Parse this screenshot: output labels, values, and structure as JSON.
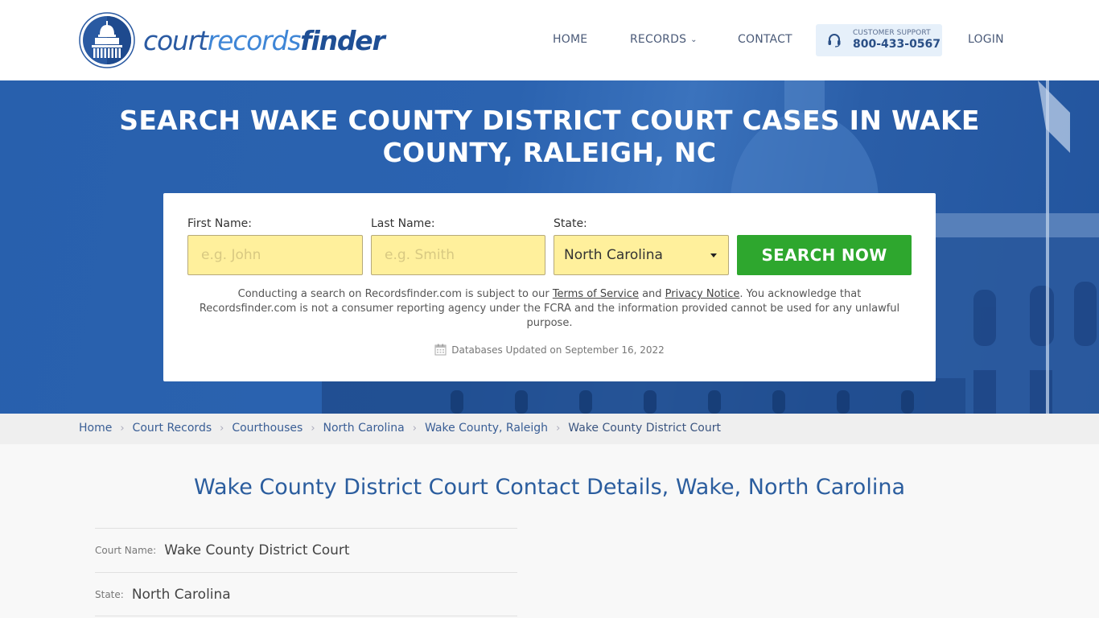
{
  "header": {
    "logo": {
      "part1": "court",
      "part2": "records",
      "part3": "finder"
    },
    "nav": [
      {
        "label": "HOME"
      },
      {
        "label": "RECORDS",
        "has_dropdown": true
      },
      {
        "label": "CONTACT"
      }
    ],
    "support": {
      "label": "CUSTOMER SUPPORT",
      "phone": "800-433-0567",
      "icon": "headset-icon"
    },
    "login_label": "LOGIN"
  },
  "hero": {
    "title": "SEARCH WAKE COUNTY DISTRICT COURT CASES IN WAKE COUNTY, RALEIGH, NC",
    "form": {
      "first_name": {
        "label": "First Name:",
        "placeholder": "e.g. John",
        "value": ""
      },
      "last_name": {
        "label": "Last Name:",
        "placeholder": "e.g. Smith",
        "value": ""
      },
      "state": {
        "label": "State:",
        "selected": "North Carolina"
      },
      "submit_label": "SEARCH NOW"
    },
    "disclaimer": {
      "pre": "Conducting a search on Recordsfinder.com is subject to our ",
      "terms": "Terms of Service",
      "and": " and ",
      "privacy": "Privacy Notice",
      "post": ". You acknowledge that Recordsfinder.com is not a consumer reporting agency under the FCRA and the information provided cannot be used for any unlawful purpose."
    },
    "updated": "Databases Updated on September 16, 2022"
  },
  "breadcrumb": [
    {
      "label": "Home"
    },
    {
      "label": "Court Records"
    },
    {
      "label": "Courthouses"
    },
    {
      "label": "North Carolina"
    },
    {
      "label": "Wake County, Raleigh"
    },
    {
      "label": "Wake County District Court"
    }
  ],
  "main": {
    "title": "Wake County District Court Contact Details, Wake, North Carolina",
    "details": [
      {
        "key": "Court Name:",
        "value": "Wake County District Court"
      },
      {
        "key": "State:",
        "value": "North Carolina"
      }
    ]
  },
  "colors": {
    "brand_blue": "#2a5aa2",
    "hero_blue": "#2860ad",
    "search_green": "#2ea72e",
    "input_yellow": "#fff09c",
    "support_bg": "#e6f0fa"
  }
}
